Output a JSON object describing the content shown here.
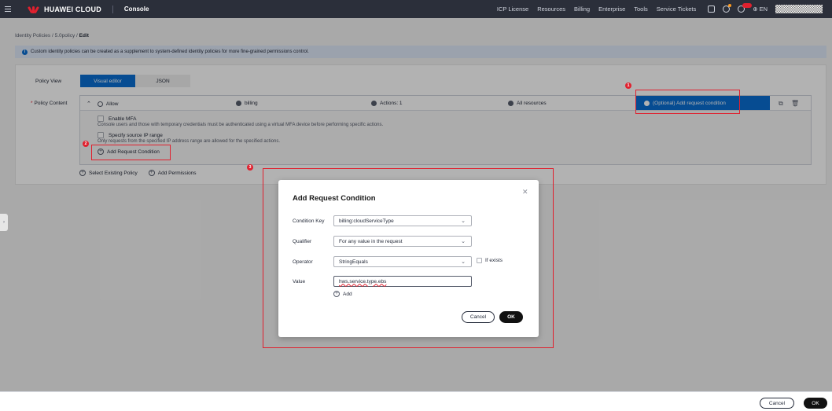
{
  "header": {
    "brand": "HUAWEI CLOUD",
    "console": "Console",
    "nav": [
      "ICP License",
      "Resources",
      "Billing",
      "Enterprise",
      "Tools",
      "Service Tickets"
    ],
    "language": "EN"
  },
  "breadcrumb": {
    "path": "Identity Policies  /  5.0policy  /",
    "current": "Edit"
  },
  "info_message": "Custom identity policies can be created as a supplement to system-defined identity policies for more fine-grained permissions control.",
  "policy_view": {
    "label": "Policy View",
    "tabs": [
      "Visual editor",
      "JSON"
    ],
    "active_tab": "Visual editor"
  },
  "policy_content": {
    "label": "Policy Content",
    "row": {
      "effect": "Allow",
      "service": "billing",
      "actions": "Actions: 1",
      "resources": "All resources",
      "condition": "(Optional) Add request condition"
    },
    "enable_mfa": {
      "label": "Enable MFA",
      "description": "Console users and those with temporary credentials must be authenticated using a virtual MFA device before performing specific actions."
    },
    "source_ip": {
      "label": "Specify source IP range",
      "description": "Only requests from the specified IP address range are allowed for the specified actions."
    },
    "add_request_condition": "Add Request Condition"
  },
  "bottom_links": {
    "select_existing": "Select Existing Policy",
    "add_permissions": "Add Permissions"
  },
  "footer": {
    "cancel": "Cancel",
    "ok": "OK"
  },
  "dialog": {
    "title": "Add Request Condition",
    "condition_key_label": "Condition Key",
    "condition_key_value": "billing:cloudServiceType",
    "qualifier_label": "Qualifier",
    "qualifier_value": "For any value in the request",
    "operator_label": "Operator",
    "operator_value": "StringEquals",
    "if_exists_label": "If exists",
    "value_label": "Value",
    "value_input": "hws.service.type.ebs",
    "add_label": "Add",
    "cancel": "Cancel",
    "ok": "OK"
  },
  "annotations": [
    "1",
    "2",
    "3"
  ],
  "colors": {
    "topbar": "#2b2f3a",
    "primary": "#0a6ed1",
    "annotation": "#e0202e"
  }
}
